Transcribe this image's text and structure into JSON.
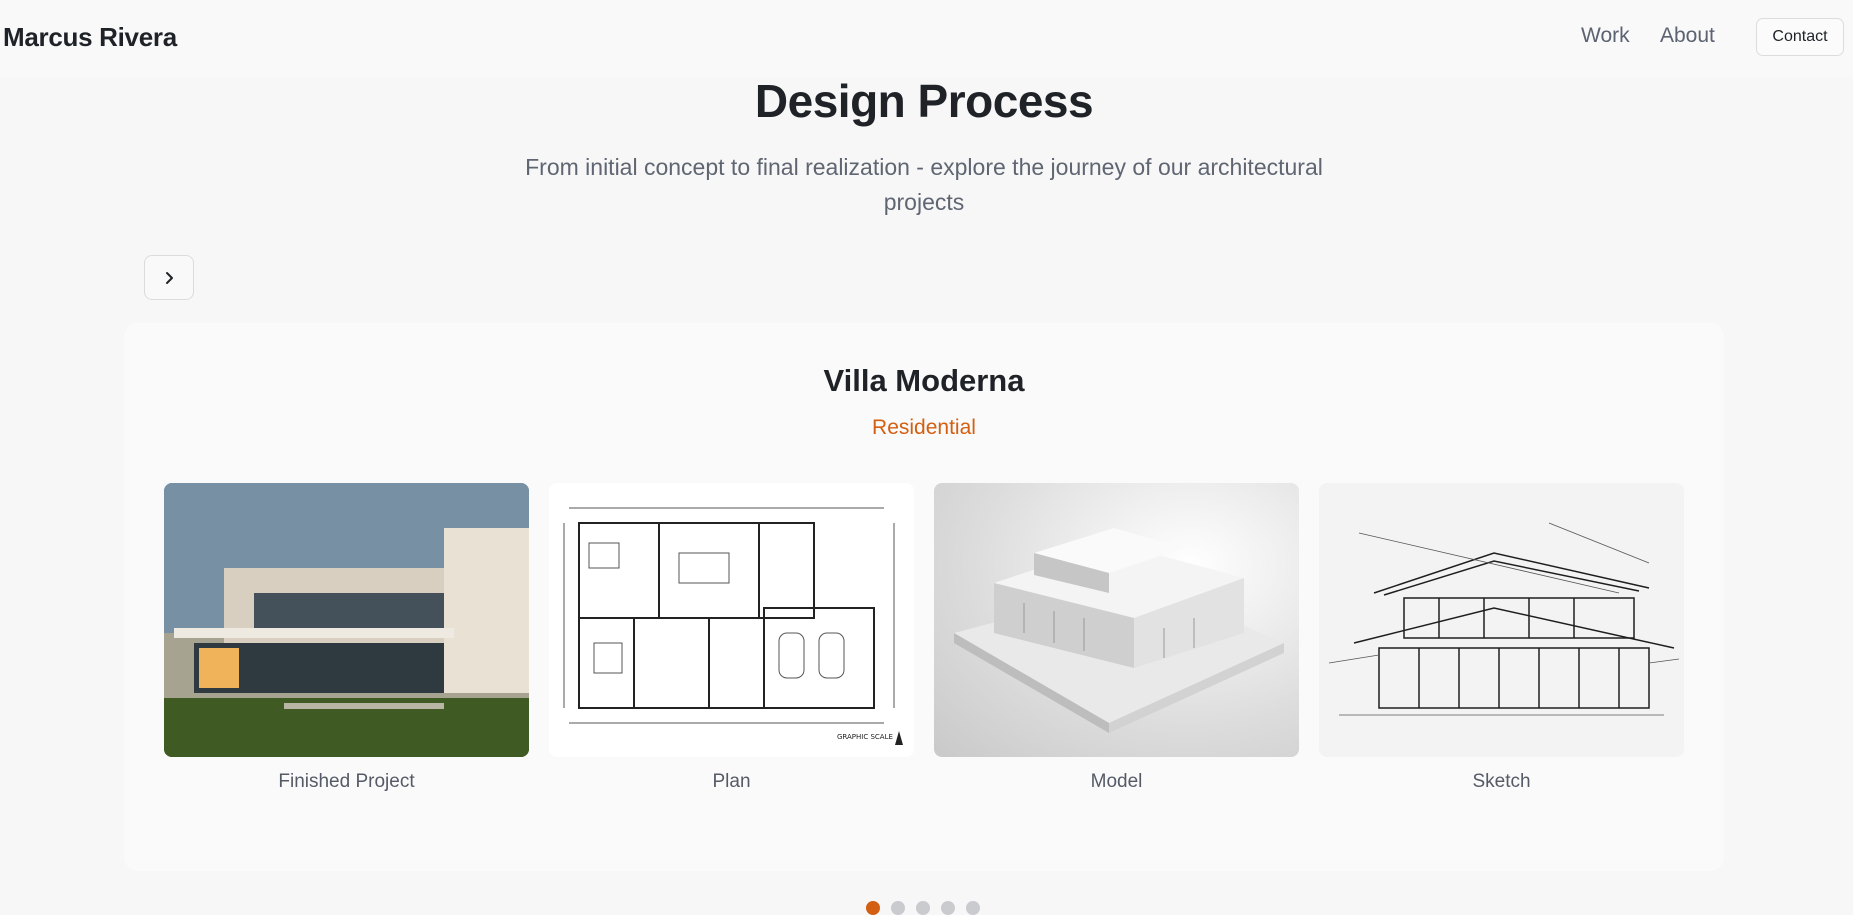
{
  "header": {
    "brand": "Marcus Rivera",
    "nav": [
      {
        "label": "Work"
      },
      {
        "label": "About"
      }
    ],
    "contact_label": "Contact"
  },
  "hero": {
    "title": "Design Process",
    "subtitle": "From initial concept to final realization - explore the journey of our architectural projects"
  },
  "carousel": {
    "next_icon": "chevron-right-icon",
    "project": {
      "title": "Villa Moderna",
      "category": "Residential",
      "stages": [
        {
          "label": "Finished Project",
          "image": "modern-villa-photo"
        },
        {
          "label": "Plan",
          "image": "floor-plan-drawing"
        },
        {
          "label": "Model",
          "image": "white-architectural-model"
        },
        {
          "label": "Sketch",
          "image": "pencil-sketch-house"
        }
      ]
    },
    "dots": {
      "count": 5,
      "active_index": 0
    },
    "colors": {
      "accent": "#d35f12",
      "dot_inactive": "#c9cbcf"
    }
  }
}
